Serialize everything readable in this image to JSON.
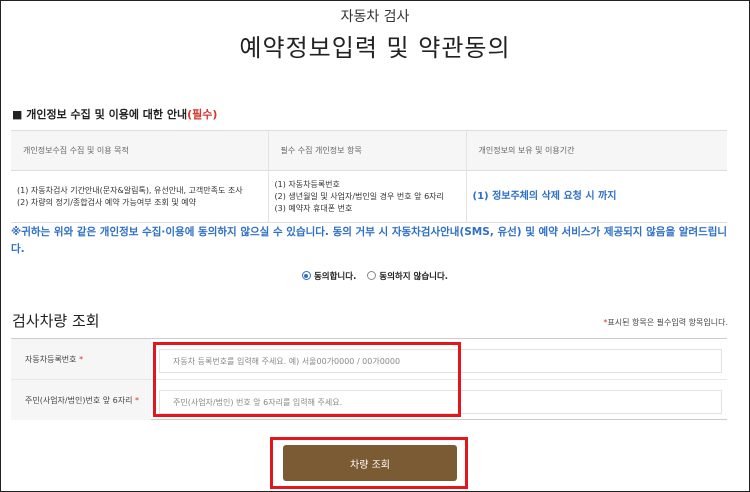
{
  "header": {
    "subtitle": "자동차 검사",
    "title": "예약정보입력 및 약관동의"
  },
  "privacy": {
    "heading": "개인정보 수집 및 이용에 대한 안내",
    "heading_required": "(필수)",
    "columns": [
      "개인정보수집 수집 및 이용 목적",
      "필수 수집 개인정보 항목",
      "개인정보의 보유 및 이용기간"
    ],
    "purpose_lines": [
      "(1) 자동차검사 기간안내(문자&알림톡), 유선안내, 고객만족도 조사",
      "(2) 차량의 정기/종합검사 예약 가능여부 조회 및 예약"
    ],
    "items_lines": [
      "(1) 자동차등록번호",
      "(2) 생년월일 및 사업자/법인일 경우 번호 앞 6자리",
      "(3) 예약자 휴대폰 번호"
    ],
    "retention": "(1) 정보주체의 삭제 요청 시 까지",
    "notice": "※귀하는 위와 같은 개인정보 수집·이용에 동의하지 않으실 수 있습니다. 동의 거부 시 자동차검사안내(SMS, 유선) 및 예약 서비스가 제공되지 않음을 알려드립니다.",
    "agree_label": "동의합니다.",
    "disagree_label": "동의하지 않습니다."
  },
  "vehicle_lookup": {
    "section_title": "검사차량 조회",
    "required_note_mark": "*",
    "required_note_text": "표시된 항목은 필수입력 항목입니다.",
    "fields": [
      {
        "label": "자동차등록번호",
        "mark": "*",
        "placeholder": "자동차 등록번호를 입력해 주세요. 예) 서울00가0000 / 00가0000",
        "value": ""
      },
      {
        "label": "주민(사업자/법인)번호 앞 6자리",
        "mark": "*",
        "placeholder": "주민(사업자/법인) 번호 앞 6자리를 입력해 주세요.",
        "value": ""
      }
    ],
    "search_button": "차량 조회"
  },
  "colors": {
    "accent_blue": "#2e6fc8",
    "required_red": "#d4352f",
    "button_brown": "#7b5b34",
    "highlight_red": "#e4161b"
  }
}
